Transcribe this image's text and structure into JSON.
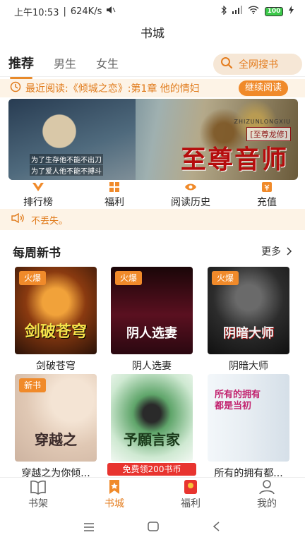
{
  "status_bar": {
    "time": "上午10:53",
    "speed": "624K/s",
    "battery": "100"
  },
  "header": {
    "title": "书城"
  },
  "tabs": [
    {
      "label": "推荐",
      "active": true
    },
    {
      "label": "男生",
      "active": false
    },
    {
      "label": "女生",
      "active": false
    }
  ],
  "search": {
    "label": "全网搜书"
  },
  "recent": {
    "text": "最近阅读:《倾城之恋》:第1章 他的情妇",
    "button": "继续阅读"
  },
  "banner": {
    "title": "至尊音师",
    "tag": "[至尊龙修]",
    "subtag": "ZHIZUNLONGXIU",
    "line1": "为了生存他不能不出刀",
    "line2": "为了爱人他不能不搏斗"
  },
  "quick_menu": [
    {
      "label": "排行榜",
      "icon": "ranking-icon"
    },
    {
      "label": "福利",
      "icon": "grid-icon"
    },
    {
      "label": "阅读历史",
      "icon": "eye-icon"
    },
    {
      "label": "充值",
      "icon": "wallet-icon"
    }
  ],
  "notice": {
    "text": "不丢失。"
  },
  "section": {
    "title": "每周新书",
    "more": "更多"
  },
  "books": [
    {
      "title": "剑破苍穹",
      "badge": "火爆",
      "cover_text": "剑破苍穹",
      "cover_color": "#5a2a10"
    },
    {
      "title": "阴人选妻",
      "badge": "火爆",
      "cover_text": "阴人选妻",
      "cover_color": "#3a0d14"
    },
    {
      "title": "阴暗大师",
      "badge": "火爆",
      "cover_text": "阴暗大师",
      "cover_color": "#2b2b2b"
    },
    {
      "title": "穿越之为你倾...",
      "badge": "新书",
      "cover_text": "穿越之",
      "cover_color": "#e9d6c6"
    },
    {
      "title": "",
      "badge": "",
      "cover_text": "予願言家",
      "cover_color": "#d6ecd8"
    },
    {
      "title": "所有的拥有都...",
      "badge": "",
      "cover_text": "所有的拥有都是当初",
      "cover_color": "#eaf2f7"
    }
  ],
  "promo": {
    "text": "免费领200书币"
  },
  "bottom_nav": [
    {
      "label": "书架",
      "active": false
    },
    {
      "label": "书城",
      "active": true
    },
    {
      "label": "福利",
      "active": false
    },
    {
      "label": "我的",
      "active": false
    }
  ],
  "colors": {
    "accent": "#e47d1f",
    "promo": "#e8342f"
  }
}
